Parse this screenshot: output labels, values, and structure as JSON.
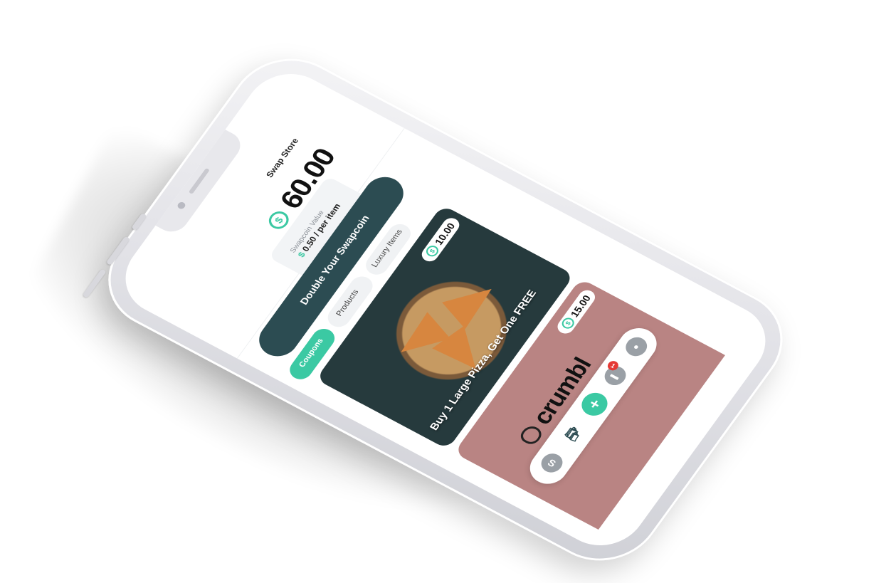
{
  "header": {
    "title": "Swap Store",
    "balance": "60.00",
    "coin_symbol": "$"
  },
  "swapcoin_value": {
    "label": "Swapcoin Value",
    "currency": "$",
    "amount": "0.50 / per item"
  },
  "promo_button": {
    "label": "Double Your Swapcoin"
  },
  "tabs": [
    {
      "label": "Coupons",
      "active": true
    },
    {
      "label": "Products",
      "active": false
    },
    {
      "label": "Luxury Items",
      "active": false
    }
  ],
  "cards": [
    {
      "title": "Buy 1 Large Pizza, Get One FREE",
      "price": "10.00"
    },
    {
      "brand": "crumbl",
      "price": "15.00"
    }
  ],
  "bottom_nav": {
    "items": [
      {
        "icon": "swapcoin-icon"
      },
      {
        "icon": "shopping-bag-icon"
      },
      {
        "icon": "plus-icon"
      },
      {
        "icon": "chat-icon",
        "badge": "1"
      },
      {
        "icon": "user-icon"
      }
    ]
  },
  "colors": {
    "accent": "#3bc9a3",
    "dark_teal": "#2c4c52",
    "card_pink": "#b98483",
    "badge_red": "#e53935"
  }
}
